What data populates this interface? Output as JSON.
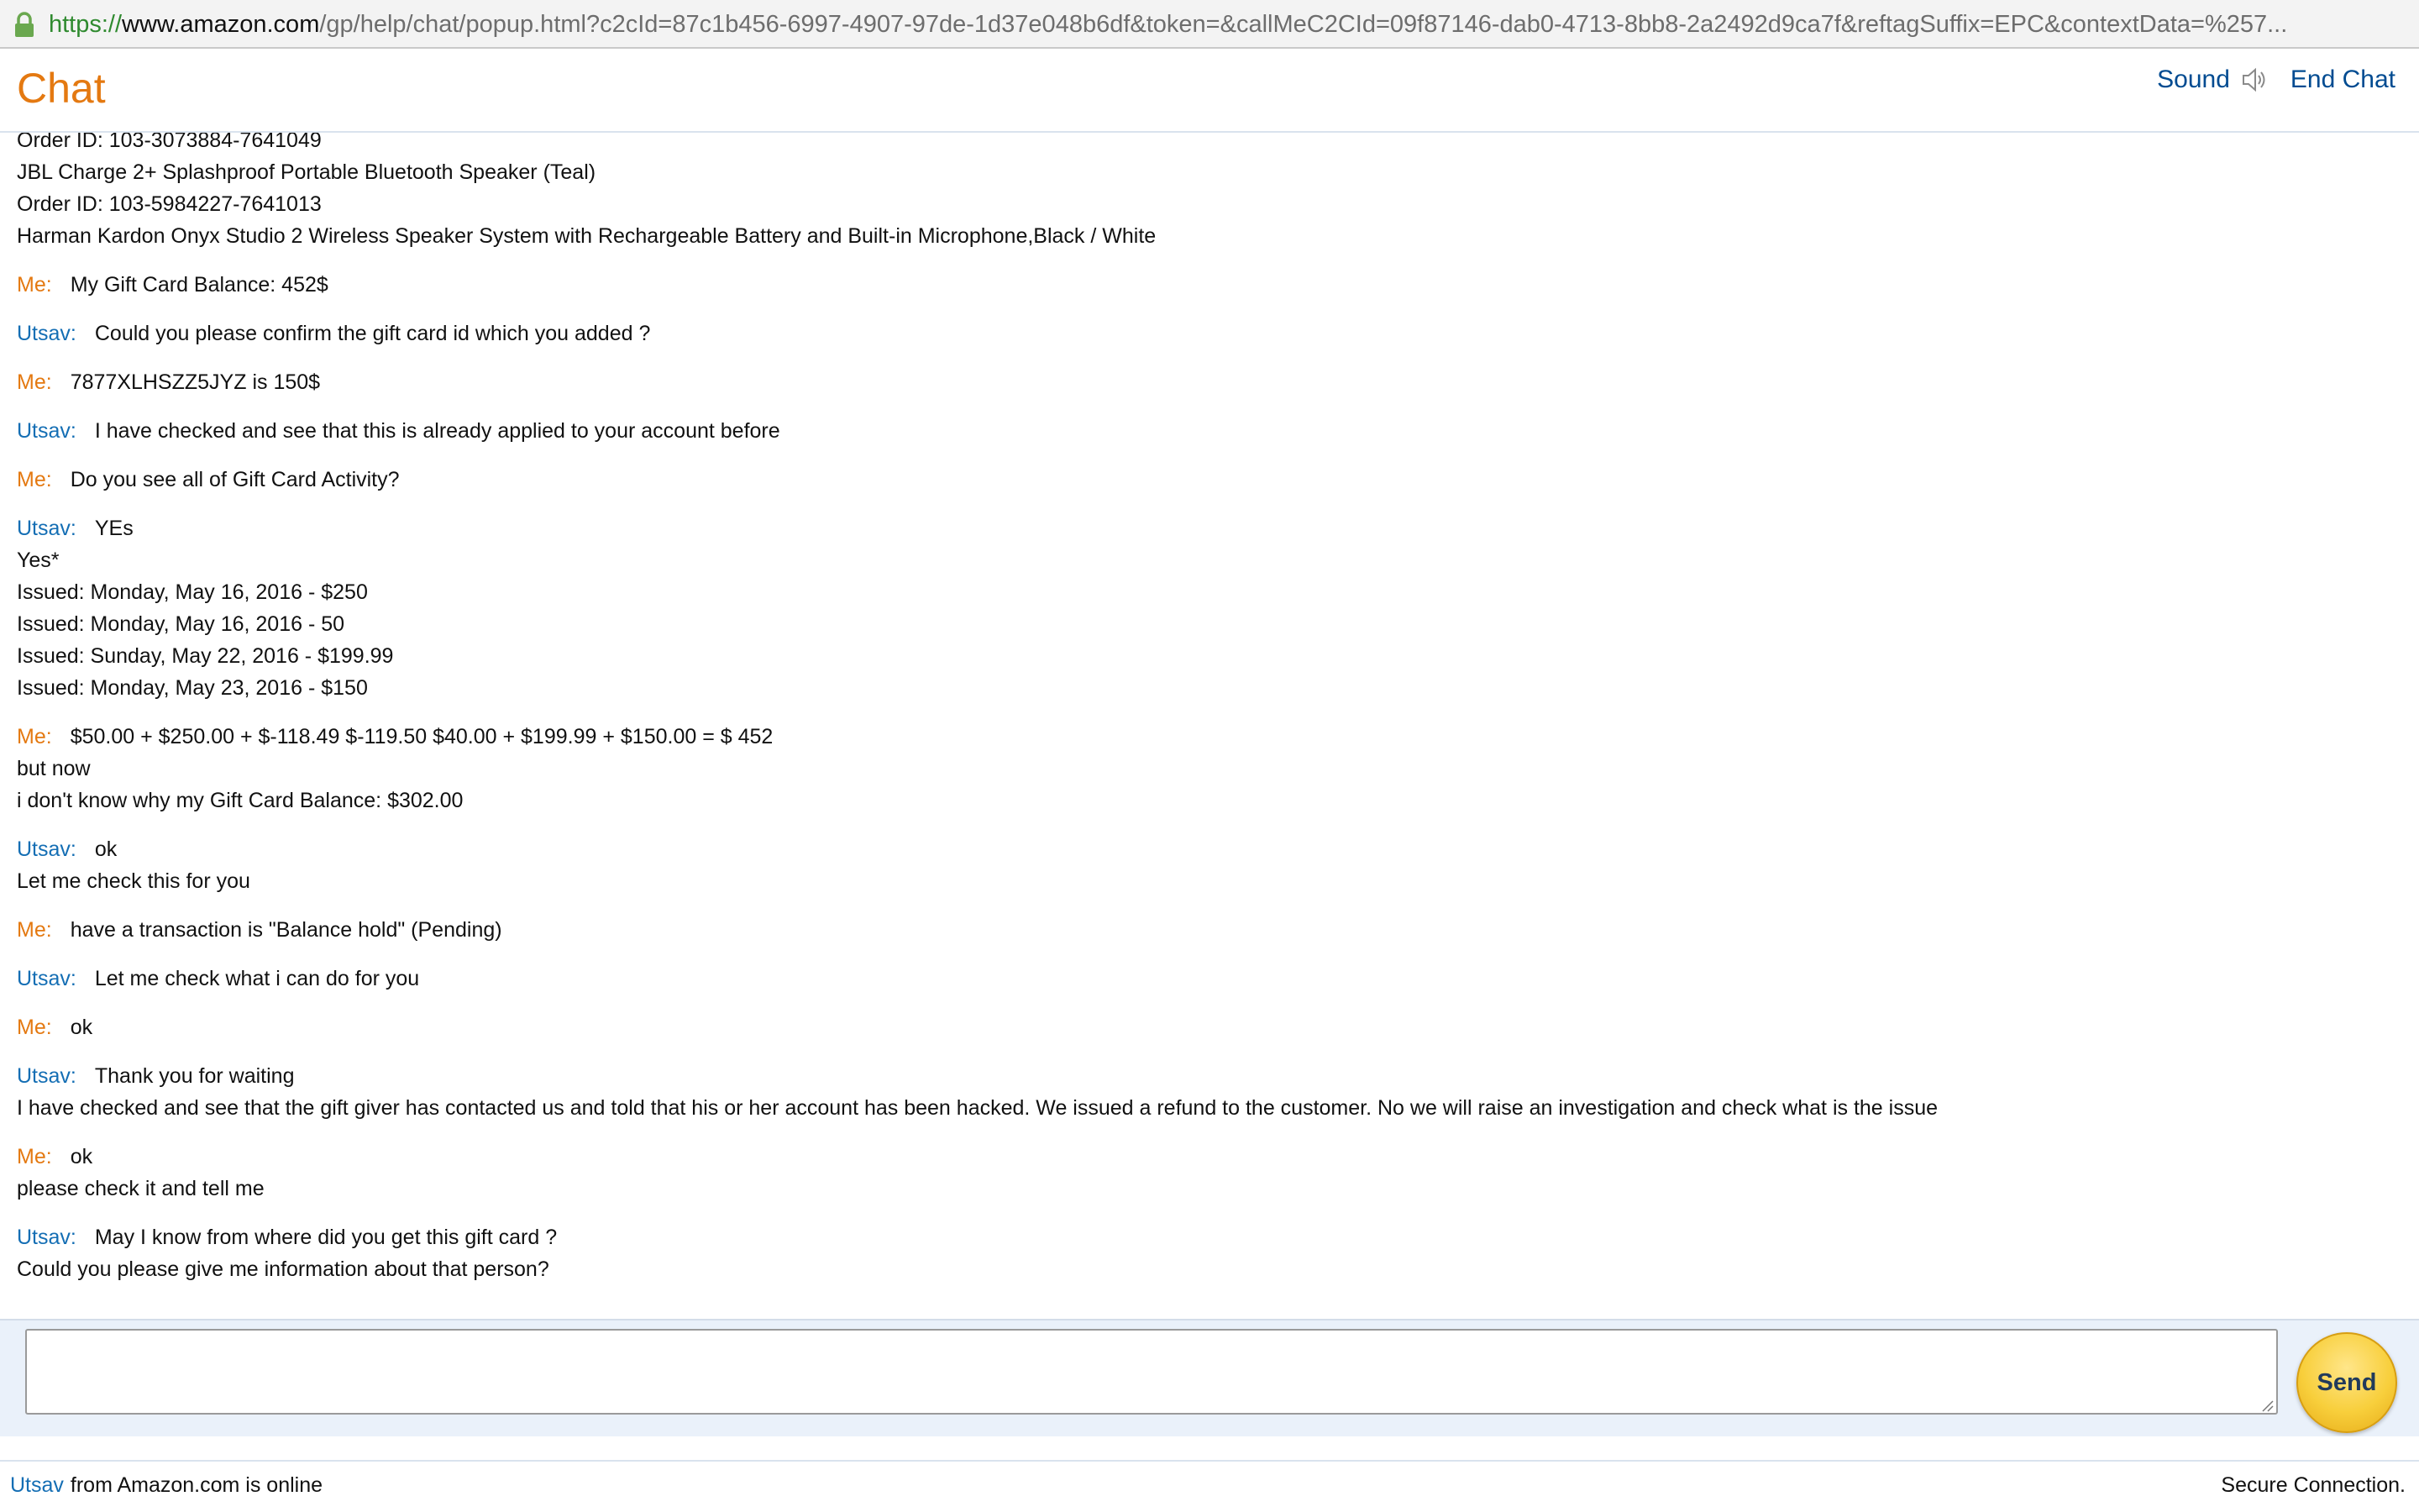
{
  "browser": {
    "url_protocol": "https://",
    "url_host": "www.amazon.com",
    "url_path": "/gp/help/chat/popup.html?c2cId=87c1b456-6997-4907-97de-1d37e048b6df&token=&callMeC2CId=09f87146-dab0-4713-8bb8-2a2492d9ca7f&reftagSuffix=EPC&contextData=%257..."
  },
  "header": {
    "title": "Chat",
    "sound_label": "Sound",
    "end_chat_label": "End Chat"
  },
  "transcript": {
    "partial_lines": [
      "Order ID: 103-3073884-7641049",
      "JBL Charge 2+ Splashproof Portable Bluetooth Speaker (Teal)",
      "Order ID: 103-5984227-7641013",
      "Harman Kardon Onyx Studio 2 Wireless Speaker System with Rechargeable Battery and Built-in Microphone,Black / White"
    ],
    "messages": [
      {
        "speaker": "Me:",
        "role": "me",
        "lines": [
          "My Gift Card Balance: 452$"
        ]
      },
      {
        "speaker": "Utsav:",
        "role": "agent",
        "lines": [
          "Could you please confirm the gift card id which you added ?"
        ]
      },
      {
        "speaker": "Me:",
        "role": "me",
        "lines": [
          "7877XLHSZZ5JYZ is 150$"
        ]
      },
      {
        "speaker": "Utsav:",
        "role": "agent",
        "lines": [
          "I have checked and see that this is already applied to your account before"
        ]
      },
      {
        "speaker": "Me:",
        "role": "me",
        "lines": [
          "Do you see all of Gift Card Activity?"
        ]
      },
      {
        "speaker": "Utsav:",
        "role": "agent",
        "lines": [
          "YEs",
          "Yes*",
          "Issued: Monday, May 16, 2016 - $250",
          "Issued: Monday, May 16, 2016 - 50",
          "Issued: Sunday, May 22, 2016 - $199.99",
          "Issued: Monday, May 23, 2016 - $150"
        ]
      },
      {
        "speaker": "Me:",
        "role": "me",
        "lines": [
          "$50.00 + $250.00 + $-118.49 $-119.50 $40.00 + $199.99 + $150.00 = $ 452",
          "but now",
          "i don't know why my Gift Card Balance: $302.00"
        ]
      },
      {
        "speaker": "Utsav:",
        "role": "agent",
        "lines": [
          "ok",
          "Let me check this for you"
        ]
      },
      {
        "speaker": "Me:",
        "role": "me",
        "lines": [
          "have a transaction is \"Balance hold\" (Pending)"
        ]
      },
      {
        "speaker": "Utsav:",
        "role": "agent",
        "lines": [
          "Let me check what i can do for you"
        ]
      },
      {
        "speaker": "Me:",
        "role": "me",
        "lines": [
          "ok"
        ]
      },
      {
        "speaker": "Utsav:",
        "role": "agent",
        "lines": [
          "Thank you for waiting",
          "I have checked and see that the gift giver has contacted us and told that his or her account has been hacked. We issued a refund to the customer. No we will raise an investigation and check what is the issue"
        ]
      },
      {
        "speaker": "Me:",
        "role": "me",
        "lines": [
          "ok",
          "please check it and tell me"
        ]
      },
      {
        "speaker": "Utsav:",
        "role": "agent",
        "lines": [
          "May I know from where did you get this gift card ?",
          "Could you please give me information about that person?"
        ]
      }
    ]
  },
  "composer": {
    "input_value": "",
    "send_label": "Send"
  },
  "footer": {
    "agent_name": "Utsav",
    "status_text": "from Amazon.com is online",
    "secure_label": "Secure Connection."
  },
  "colors": {
    "brand_orange": "#e47911",
    "agent_blue": "#146eb4",
    "link_blue": "#004b91",
    "send_gold": "#f8cf3c"
  }
}
